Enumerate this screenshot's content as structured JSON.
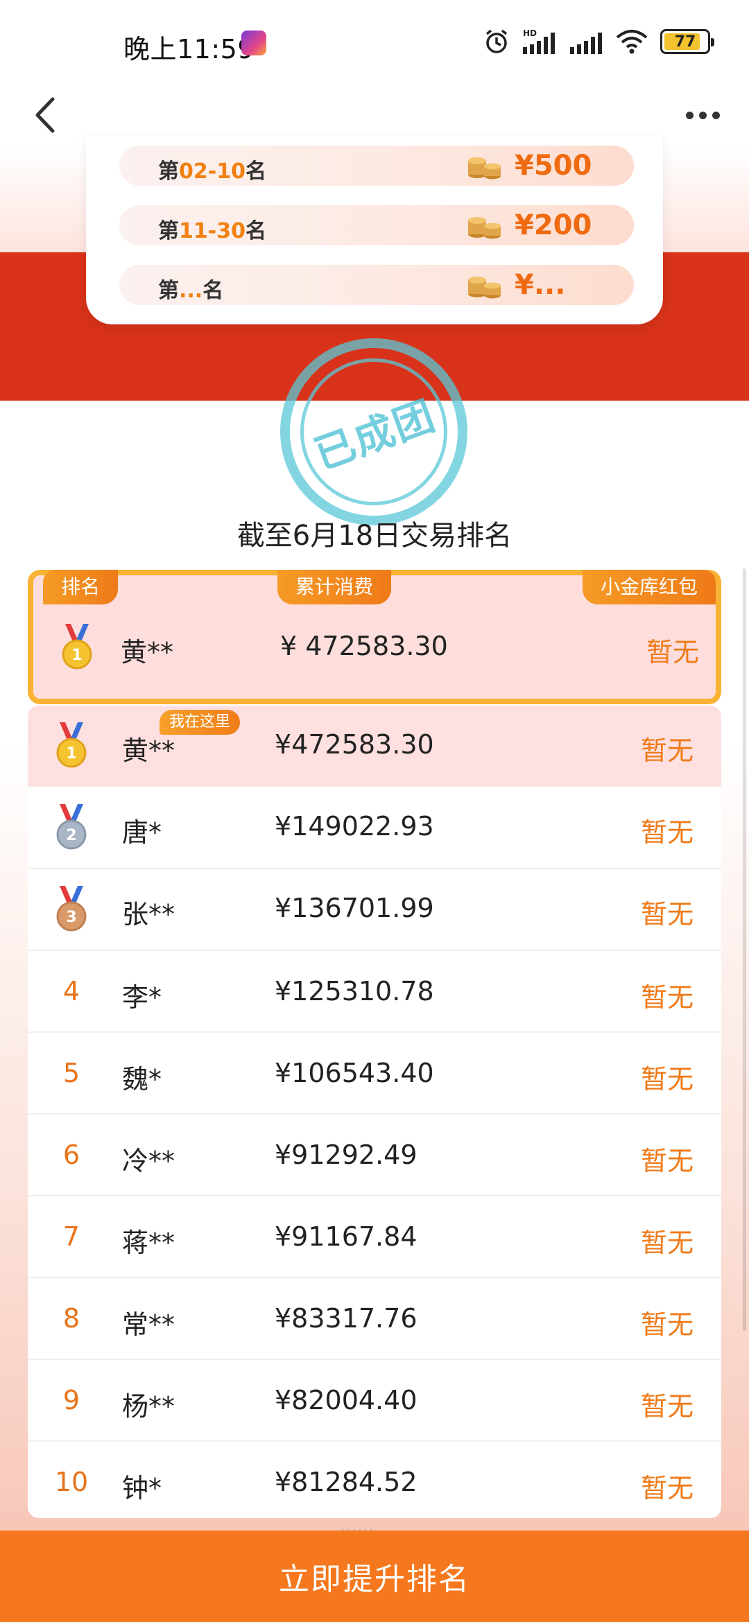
{
  "status_bar": {
    "time": "晚上11:59",
    "network": "HD",
    "battery": "77",
    "battery_level": 0.77
  },
  "rewards": [
    {
      "prefix": "第",
      "range": "02-10",
      "suffix": "名",
      "amount": "¥500"
    },
    {
      "prefix": "第",
      "range": "11-30",
      "suffix": "名",
      "amount": "¥200"
    },
    {
      "prefix": "第",
      "range": "...",
      "suffix": "名",
      "amount": "¥..."
    }
  ],
  "stamp": {
    "text": "已成团"
  },
  "ranking": {
    "title": "截至6月18日交易排名",
    "headers": {
      "rank": "排名",
      "total": "累计消费",
      "reward": "小金库红包"
    },
    "my_entry": {
      "rank": 1,
      "name": "黄**",
      "amount": "¥  472583.30",
      "reward": "暂无"
    },
    "here_badge": "我在这里",
    "rows": [
      {
        "rank": 1,
        "medal": "gold",
        "name": "黄**",
        "amount": "¥472583.30",
        "reward": "暂无",
        "is_me": true
      },
      {
        "rank": 2,
        "medal": "silver",
        "name": "唐*",
        "amount": "¥149022.93",
        "reward": "暂无",
        "is_me": false
      },
      {
        "rank": 3,
        "medal": "bronze",
        "name": "张**",
        "amount": "¥136701.99",
        "reward": "暂无",
        "is_me": false
      },
      {
        "rank": 4,
        "medal": "",
        "name": "李*",
        "amount": "¥125310.78",
        "reward": "暂无",
        "is_me": false
      },
      {
        "rank": 5,
        "medal": "",
        "name": "魏*",
        "amount": "¥106543.40",
        "reward": "暂无",
        "is_me": false
      },
      {
        "rank": 6,
        "medal": "",
        "name": "冷**",
        "amount": "¥91292.49",
        "reward": "暂无",
        "is_me": false
      },
      {
        "rank": 7,
        "medal": "",
        "name": "蒋**",
        "amount": "¥91167.84",
        "reward": "暂无",
        "is_me": false
      },
      {
        "rank": 8,
        "medal": "",
        "name": "常**",
        "amount": "¥83317.76",
        "reward": "暂无",
        "is_me": false
      },
      {
        "rank": 9,
        "medal": "",
        "name": "杨**",
        "amount": "¥82004.40",
        "reward": "暂无",
        "is_me": false
      },
      {
        "rank": 10,
        "medal": "",
        "name": "钟*",
        "amount": "¥81284.52",
        "reward": "暂无",
        "is_me": false
      }
    ]
  },
  "cta": {
    "label": "立即提升排名"
  },
  "colors": {
    "accent": "#f5781e",
    "banner_red": "#d8321a",
    "highlight_border": "#f9b233"
  }
}
